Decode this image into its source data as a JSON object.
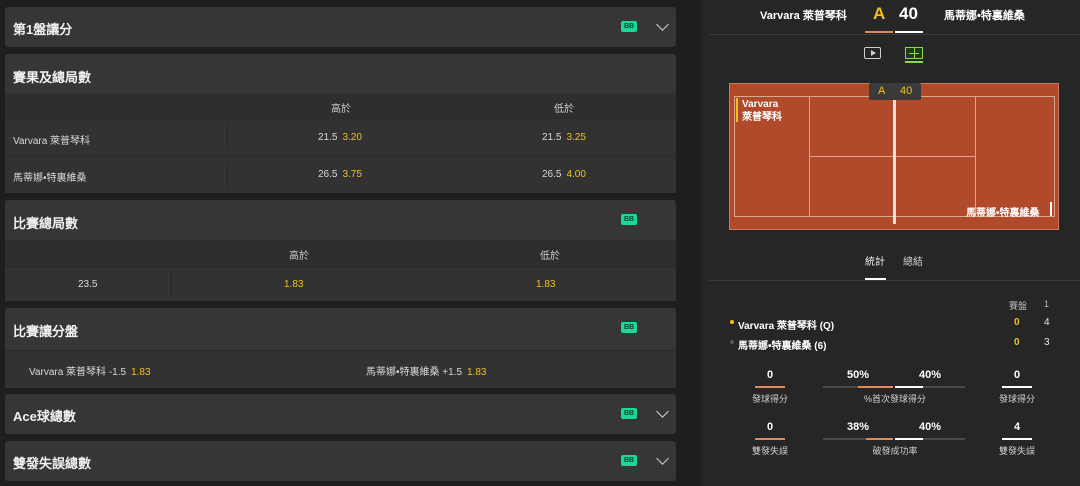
{
  "left": {
    "set1_handicap": {
      "title": "第1盤讓分",
      "badge": "BB"
    },
    "game_result_total": {
      "title": "賽果及總局數",
      "col_over": "高於",
      "col_under": "低於",
      "rows": [
        {
          "name": "Varvara 萊普琴科",
          "over_line": "21.5",
          "over_odds": "3.20",
          "under_line": "21.5",
          "under_odds": "3.25"
        },
        {
          "name": "馬蒂娜•特裏維桑",
          "over_line": "26.5",
          "over_odds": "3.75",
          "under_line": "26.5",
          "under_odds": "4.00"
        }
      ]
    },
    "match_total_games": {
      "title": "比賽總局數",
      "badge": "BB",
      "col_over": "高於",
      "col_under": "低於",
      "line": "23.5",
      "over_odds": "1.83",
      "under_odds": "1.83"
    },
    "match_set_handicap": {
      "title": "比賽讓分盤",
      "badge": "BB",
      "home_label": "Varvara 萊普琴科 -1.5",
      "home_odds": "1.83",
      "away_label": "馬蒂娜•特裏維桑 +1.5",
      "away_odds": "1.83"
    },
    "aces_total": {
      "title": "Ace球總數",
      "badge": "BB"
    },
    "double_faults_total": {
      "title": "雙發失誤總數",
      "badge": "BB"
    }
  },
  "right": {
    "player1_short": "Varvara 萊普琴科",
    "player2_short": "馬蒂娜•特裏維桑",
    "score_a": "A",
    "score_40": "40",
    "court": {
      "score_a": "A",
      "score_40": "40",
      "p1_line1": "Varvara",
      "p1_line2": "萊普琴科",
      "p2": "馬蒂娜•特裏維桑"
    },
    "tabs": {
      "stats": "統計",
      "summary": "總結"
    },
    "table": {
      "col_sets": "賽盤",
      "col_1": "1",
      "p1_name": "Varvara 萊普琴科 (Q)",
      "p1_sets": "0",
      "p1_set1": "4",
      "p2_name": "馬蒂娜•特裏維桑 (6)",
      "p2_sets": "0",
      "p2_set1": "3"
    },
    "stats": {
      "aces_p1": "0",
      "aces_label": "發球得分",
      "aces_p2": "0",
      "first_serve_p1": "50%",
      "first_serve_label": "%首次發球得分",
      "first_serve_p2": "40%",
      "first_serve_p1_frac": 0.5,
      "first_serve_p2_frac": 0.4,
      "df_p1": "0",
      "df_label": "雙發失誤",
      "df_p2": "4",
      "bp_p1": "38%",
      "bp_label": "破發成功率",
      "bp_p2": "40%",
      "bp_p1_frac": 0.38,
      "bp_p2_frac": 0.4
    }
  },
  "colors": {
    "accent_odds": "#f2c01e",
    "badge": "#19d99a",
    "court": "#b04a2b",
    "p1_bar": "#e08a5a",
    "p2_bar": "#ffffff"
  }
}
